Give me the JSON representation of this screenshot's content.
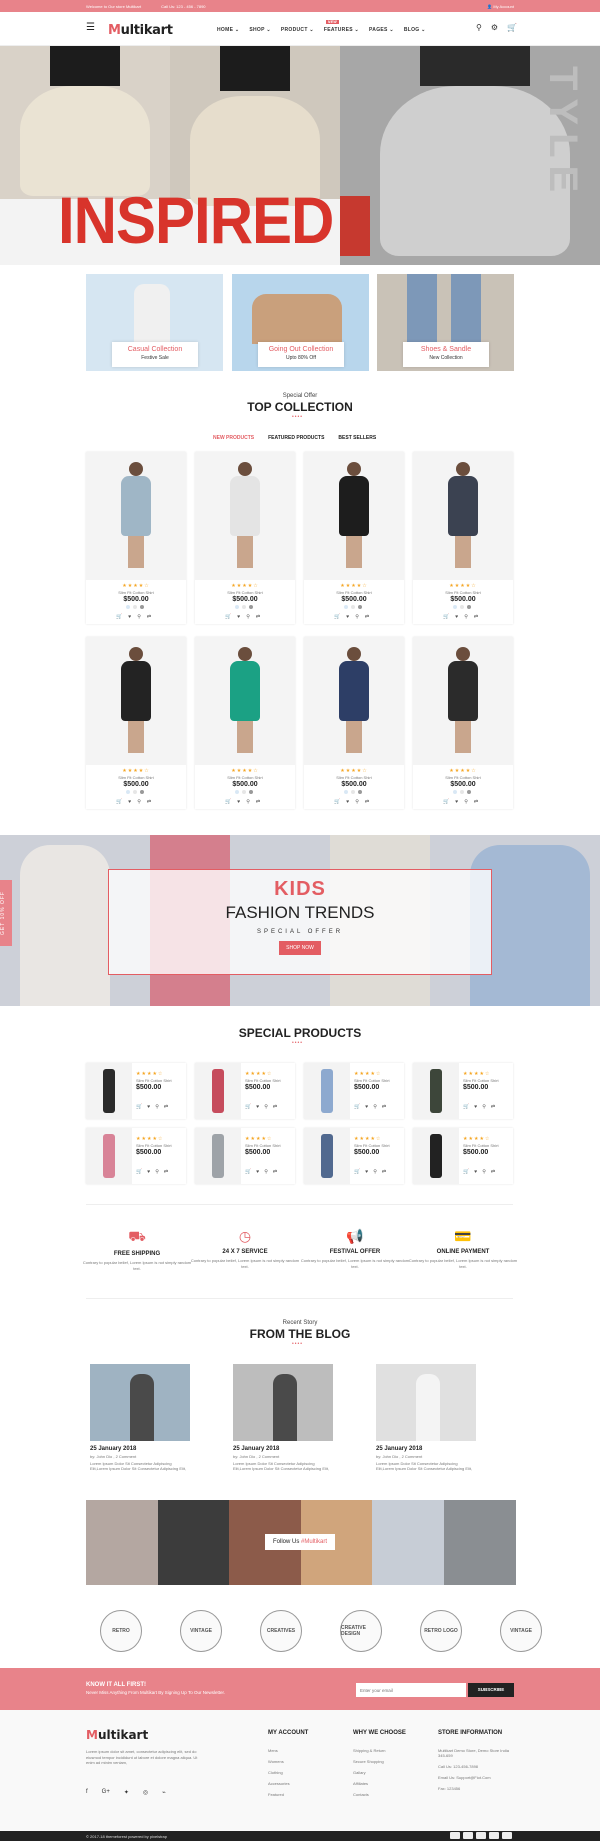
{
  "topbar": {
    "welcome": "Welcome to Our store Multikart",
    "call": "Call Us: 123 - 456 - 7890",
    "account": "My Account"
  },
  "header": {
    "logo_m": "M",
    "logo_rest": "ultikart",
    "nav": [
      {
        "label": "HOME ⌄"
      },
      {
        "label": "SHOP ⌄"
      },
      {
        "label": "PRODUCT ⌄"
      },
      {
        "label": "FEATURES ⌄",
        "badge": "NEW"
      },
      {
        "label": "PAGES ⌄"
      },
      {
        "label": "BLOG ⌄"
      }
    ]
  },
  "hero": {
    "title": "INSPIRED",
    "side_text": "TYLE"
  },
  "collections": [
    {
      "title": "Casual Collection",
      "subtitle": "Festive Sale"
    },
    {
      "title": "Going Out Collection",
      "subtitle": "Upto 80% Off"
    },
    {
      "title": "Shoes & Sandle",
      "subtitle": "New Collection"
    }
  ],
  "top_collection": {
    "subtitle": "Special Offer",
    "title": "TOP COLLECTION",
    "dots": "••••",
    "tabs": [
      "NEW PRODUCTS",
      "FEATURED PRODUCTS",
      "BEST SELLERS"
    ]
  },
  "products": [
    {
      "name": "Slim Fit Cotton Shirt",
      "price": "$500.00",
      "stars": "★★★★☆",
      "color": "#9fb6c6"
    },
    {
      "name": "Slim Fit Cotton Shirt",
      "price": "$500.00",
      "stars": "★★★★☆",
      "color": "#e4e4e4"
    },
    {
      "name": "Slim Fit Cotton Shirt",
      "price": "$500.00",
      "stars": "★★★★☆",
      "color": "#1d1d1d"
    },
    {
      "name": "Slim Fit Cotton Shirt",
      "price": "$500.00",
      "stars": "★★★★☆",
      "color": "#3b4251"
    },
    {
      "name": "Slim Fit Cotton Shirt",
      "price": "$500.00",
      "stars": "★★★★☆",
      "color": "#232323"
    },
    {
      "name": "Slim Fit Cotton Shirt",
      "price": "$500.00",
      "stars": "★★★★☆",
      "color": "#1ba184"
    },
    {
      "name": "Slim Fit Cotton Shirt",
      "price": "$500.00",
      "stars": "★★★★☆",
      "color": "#2d3e66"
    },
    {
      "name": "Slim Fit Cotton Shirt",
      "price": "$500.00",
      "stars": "★★★★☆",
      "color": "#2b2b2b"
    }
  ],
  "product_icons": {
    "cart": "🛒",
    "heart": "♥",
    "search": "⚲",
    "compare": "⇄"
  },
  "kids": {
    "title": "KIDS",
    "subtitle": "FASHION TRENDS",
    "offer": "SPECIAL OFFER",
    "button": "SHOP NOW",
    "ribbon": "GET 10% OFF"
  },
  "special": {
    "title": "SPECIAL PRODUCTS",
    "dots": "••••",
    "items": [
      {
        "name": "Slim Fit Cotton Shirt",
        "price": "$500.00",
        "stars": "★★★★☆",
        "color": "#2b2b2b"
      },
      {
        "name": "Slim Fit Cotton Shirt",
        "price": "$500.00",
        "stars": "★★★★☆",
        "color": "#c64c5d"
      },
      {
        "name": "Slim Fit Cotton Shirt",
        "price": "$500.00",
        "stars": "★★★★☆",
        "color": "#8da9cf"
      },
      {
        "name": "Slim Fit Cotton Shirt",
        "price": "$500.00",
        "stars": "★★★★☆",
        "color": "#3d463a"
      },
      {
        "name": "Slim Fit Cotton Shirt",
        "price": "$500.00",
        "stars": "★★★★☆",
        "color": "#d88397"
      },
      {
        "name": "Slim Fit Cotton Shirt",
        "price": "$500.00",
        "stars": "★★★★☆",
        "color": "#9ea3a8"
      },
      {
        "name": "Slim Fit Cotton Shirt",
        "price": "$500.00",
        "stars": "★★★★☆",
        "color": "#51698f"
      },
      {
        "name": "Slim Fit Cotton Shirt",
        "price": "$500.00",
        "stars": "★★★★☆",
        "color": "#222222"
      }
    ]
  },
  "services": [
    {
      "icon": "⛟",
      "title": "FREE SHIPPING",
      "desc": "Contrary to popular belief, Lorem Ipsum is not simply random text."
    },
    {
      "icon": "◷",
      "title": "24 X 7 SERVICE",
      "desc": "Contrary to popular belief, Lorem Ipsum is not simply random text."
    },
    {
      "icon": "📢",
      "title": "FESTIVAL OFFER",
      "desc": "Contrary to popular belief, Lorem Ipsum is not simply random text."
    },
    {
      "icon": "💳",
      "title": "ONLINE PAYMENT",
      "desc": "Contrary to popular belief, Lorem Ipsum is not simply random text."
    }
  ],
  "blog": {
    "subtitle": "Recent Story",
    "title": "FROM THE BLOG",
    "dots": "••••",
    "posts": [
      {
        "date": "25 January 2018",
        "by": "by: John Dio , 2 Comment",
        "text": "Lorem Ipsum Dolor Sit Consectetur Adipiscing Elit,Lorem Ipsum Dolor Sit Consectetur Adipiscing Elit,",
        "color": "#9fb3c2"
      },
      {
        "date": "25 January 2018",
        "by": "by: John Dio , 2 Comment",
        "text": "Lorem Ipsum Dolor Sit Consectetur Adipiscing Elit,Lorem Ipsum Dolor Sit Consectetur Adipiscing Elit,",
        "color": "#bdbdbd"
      },
      {
        "date": "25 January 2018",
        "by": "by: John Dio , 2 Comment",
        "text": "Lorem Ipsum Dolor Sit Consectetur Adipiscing Elit,Lorem Ipsum Dolor Sit Consectetur Adipiscing Elit,",
        "color": "#e0e0e0"
      }
    ]
  },
  "instagram": {
    "follow": "Follow Us ",
    "handle": "#Multikart",
    "tiles": [
      "#b4a7a1",
      "#3c3c3c",
      "#8c5b4a",
      "#d0a57c",
      "#c7cdd6",
      "#8a8e92"
    ]
  },
  "badges": [
    "RETRO",
    "VINTAGE",
    "CREATIVES",
    "CREATIVE DESIGN",
    "RETRO LOGO",
    "VINTAGE"
  ],
  "newsletter": {
    "title": "KNOW IT ALL FIRST!",
    "text": "Never Miss Anything From Multikart By Signing Up To Our Newsletter.",
    "placeholder": "Enter your email",
    "button": "SUBSCRIBE"
  },
  "footer": {
    "desc": "Lorem ipsum dolor sit amet, consectetur adipiscing elit, sed do eiusmod tempor incididunt ut labore et dolore magna aliqua. Ut enim ad minim veniam,",
    "social": [
      "f",
      "G+",
      "✦",
      "◎",
      "⌁"
    ],
    "my_account": {
      "title": "MY ACCOUNT",
      "links": [
        "Mens",
        "Womens",
        "Clothing",
        "Accessories",
        "Featured"
      ]
    },
    "why": {
      "title": "WHY WE CHOOSE",
      "links": [
        "Shipping & Return",
        "Secure Shopping",
        "Gallary",
        "Affiliates",
        "Contacts"
      ]
    },
    "store": {
      "title": "STORE INFORMATION",
      "links": [
        "Multikart Demo Store, Demo Store India 345-659",
        "Call Us: 123-456-7898",
        "Email Us: Support@Fiot.Com",
        "Fax: 123456"
      ]
    },
    "copyright": "© 2017-18 themeforest powered by pixelstrap"
  }
}
